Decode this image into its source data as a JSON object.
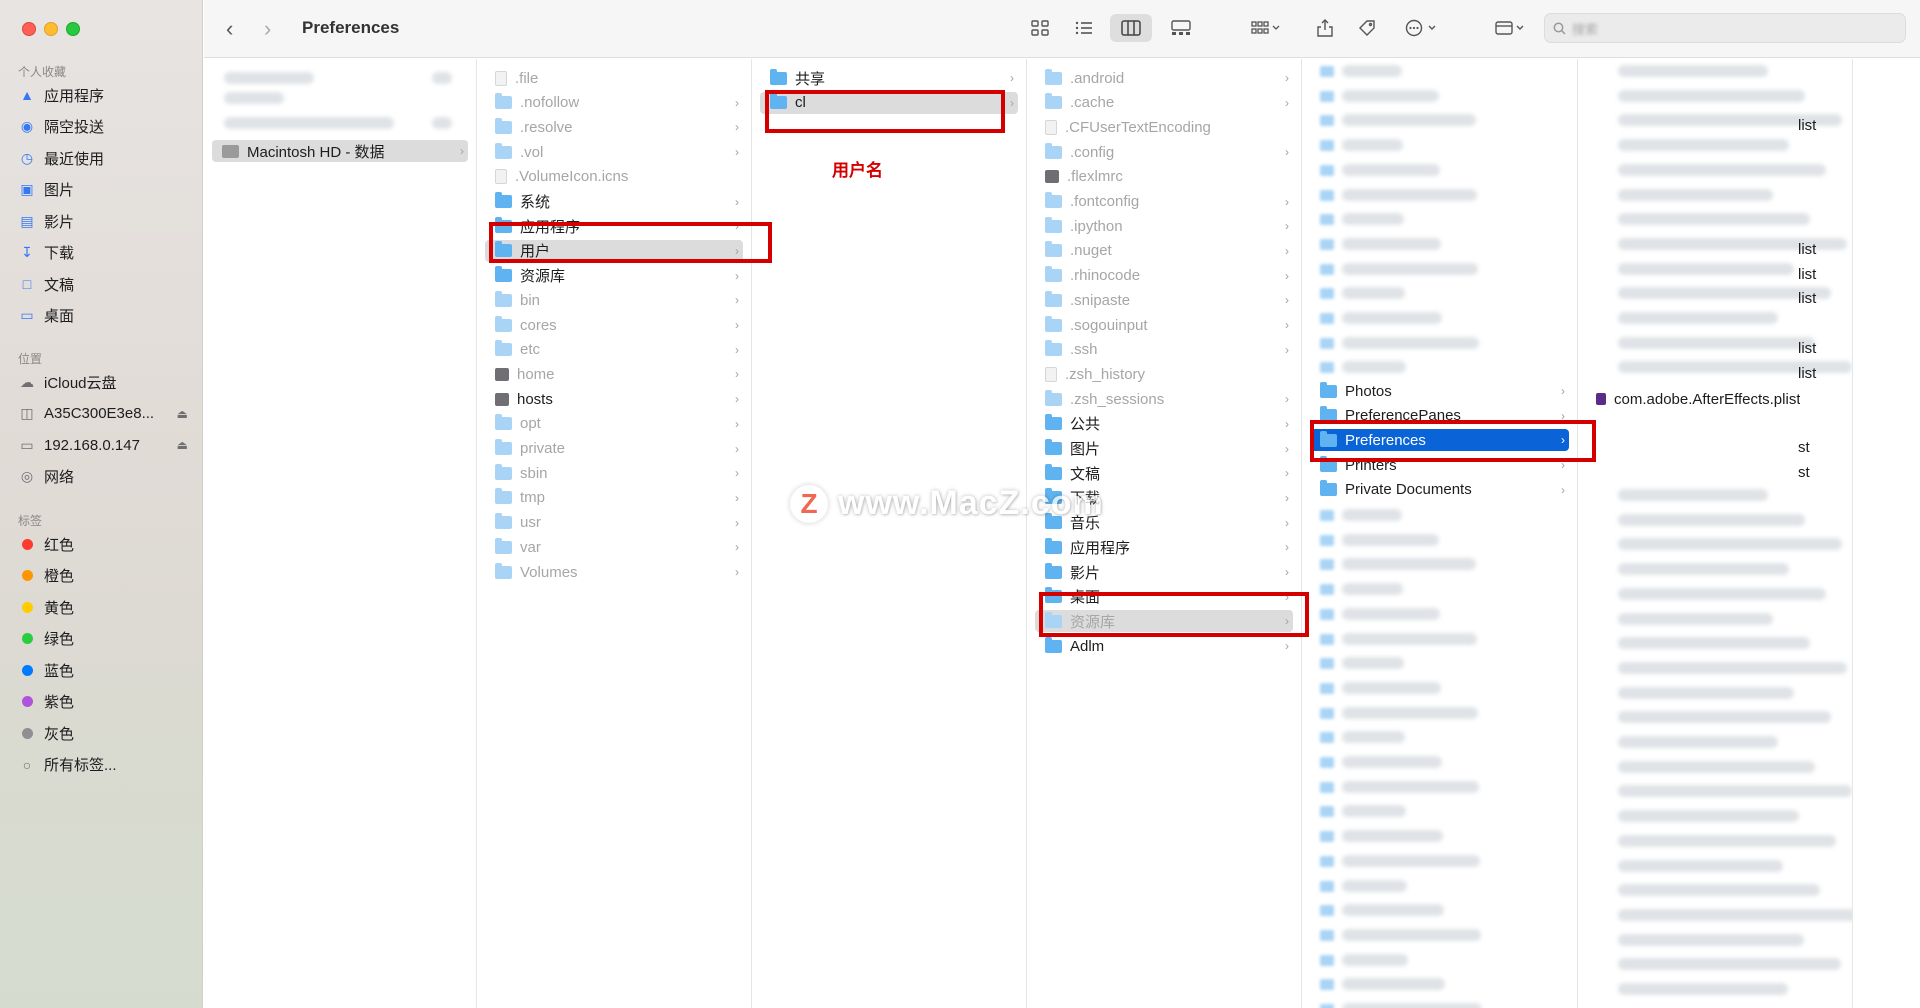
{
  "window": {
    "title": "Preferences"
  },
  "colors": {
    "accent": "#0a64d8",
    "annotation": "#d40000",
    "selection_grey": "#dcdcdc"
  },
  "sidebar": {
    "favorites_header": "个人收藏",
    "favorites": [
      {
        "label": "应用程序",
        "icon": "applications-icon"
      },
      {
        "label": "隔空投送",
        "icon": "airdrop-icon"
      },
      {
        "label": "最近使用",
        "icon": "recents-icon"
      },
      {
        "label": "图片",
        "icon": "pictures-icon"
      },
      {
        "label": "影片",
        "icon": "movies-icon"
      },
      {
        "label": "下载",
        "icon": "downloads-icon"
      },
      {
        "label": "文稿",
        "icon": "documents-icon"
      },
      {
        "label": "桌面",
        "icon": "desktop-icon"
      }
    ],
    "locations_header": "位置",
    "locations": [
      {
        "label": "iCloud云盘",
        "icon": "icloud-icon"
      },
      {
        "label": "A35C300E3e8...",
        "icon": "disk-icon",
        "eject": true
      },
      {
        "label": "192.168.0.147",
        "icon": "display-icon",
        "eject": true
      },
      {
        "label": "网络",
        "icon": "network-icon"
      }
    ],
    "tags_header": "标签",
    "tags": [
      {
        "label": "红色",
        "color": "#ff3b30"
      },
      {
        "label": "橙色",
        "color": "#ff9500"
      },
      {
        "label": "黄色",
        "color": "#ffcc00"
      },
      {
        "label": "绿色",
        "color": "#28cd41"
      },
      {
        "label": "蓝色",
        "color": "#007aff"
      },
      {
        "label": "紫色",
        "color": "#af52de"
      },
      {
        "label": "灰色",
        "color": "#8e8e93"
      },
      {
        "label": "所有标签...",
        "color": ""
      }
    ]
  },
  "toolbar": {
    "search_placeholder": "搜索"
  },
  "columns": {
    "col1": [
      {
        "label": "Macintosh HD - 数据",
        "type": "drive",
        "chevron": true,
        "selected": "grey"
      }
    ],
    "col2": [
      {
        "label": ".file",
        "type": "file",
        "hidden": true
      },
      {
        "label": ".nofollow",
        "type": "folder",
        "hidden": true,
        "chevron": true
      },
      {
        "label": ".resolve",
        "type": "folder",
        "hidden": true,
        "chevron": true
      },
      {
        "label": ".vol",
        "type": "folder",
        "hidden": true,
        "chevron": true
      },
      {
        "label": ".VolumeIcon.icns",
        "type": "file",
        "hidden": true
      },
      {
        "label": "系统",
        "type": "folder",
        "chevron": true
      },
      {
        "label": "应用程序",
        "type": "folder",
        "chevron": true
      },
      {
        "label": "用户",
        "type": "folder",
        "chevron": true,
        "selected": "grey"
      },
      {
        "label": "资源库",
        "type": "folder",
        "chevron": true
      },
      {
        "label": "bin",
        "type": "folder",
        "hidden": true,
        "chevron": true
      },
      {
        "label": "cores",
        "type": "folder",
        "hidden": true,
        "chevron": true
      },
      {
        "label": "etc",
        "type": "folder",
        "hidden": true,
        "chevron": true
      },
      {
        "label": "home",
        "type": "dark",
        "hidden": true,
        "chevron": true
      },
      {
        "label": "hosts",
        "type": "dark",
        "chevron": true
      },
      {
        "label": "opt",
        "type": "folder",
        "hidden": true,
        "chevron": true
      },
      {
        "label": "private",
        "type": "folder",
        "hidden": true,
        "chevron": true
      },
      {
        "label": "sbin",
        "type": "folder",
        "hidden": true,
        "chevron": true
      },
      {
        "label": "tmp",
        "type": "folder",
        "hidden": true,
        "chevron": true
      },
      {
        "label": "usr",
        "type": "folder",
        "hidden": true,
        "chevron": true
      },
      {
        "label": "var",
        "type": "folder",
        "hidden": true,
        "chevron": true
      },
      {
        "label": "Volumes",
        "type": "folder",
        "hidden": true,
        "chevron": true
      }
    ],
    "col3": [
      {
        "label": "共享",
        "type": "folder",
        "chevron": true
      },
      {
        "label": "cl",
        "type": "folder",
        "chevron": true,
        "selected": "grey"
      }
    ],
    "col4": [
      {
        "label": ".android",
        "type": "folder",
        "hidden": true,
        "chevron": true
      },
      {
        "label": ".cache",
        "type": "folder",
        "hidden": true,
        "chevron": true
      },
      {
        "label": ".CFUserTextEncoding",
        "type": "file",
        "hidden": true
      },
      {
        "label": ".config",
        "type": "folder",
        "hidden": true,
        "chevron": true
      },
      {
        "label": ".flexlmrc",
        "type": "dark",
        "hidden": true
      },
      {
        "label": ".fontconfig",
        "type": "folder",
        "hidden": true,
        "chevron": true
      },
      {
        "label": ".ipython",
        "type": "folder",
        "hidden": true,
        "chevron": true
      },
      {
        "label": ".nuget",
        "type": "folder",
        "hidden": true,
        "chevron": true
      },
      {
        "label": ".rhinocode",
        "type": "folder",
        "hidden": true,
        "chevron": true
      },
      {
        "label": ".snipaste",
        "type": "folder",
        "hidden": true,
        "chevron": true
      },
      {
        "label": ".sogouinput",
        "type": "folder",
        "hidden": true,
        "chevron": true
      },
      {
        "label": ".ssh",
        "type": "folder",
        "hidden": true,
        "chevron": true
      },
      {
        "label": ".zsh_history",
        "type": "file",
        "hidden": true
      },
      {
        "label": ".zsh_sessions",
        "type": "folder",
        "hidden": true,
        "chevron": true
      },
      {
        "label": "公共",
        "type": "folder",
        "chevron": true
      },
      {
        "label": "图片",
        "type": "folder",
        "chevron": true
      },
      {
        "label": "文稿",
        "type": "folder",
        "chevron": true
      },
      {
        "label": "下载",
        "type": "folder",
        "chevron": true
      },
      {
        "label": "音乐",
        "type": "folder",
        "chevron": true
      },
      {
        "label": "应用程序",
        "type": "folder",
        "chevron": true
      },
      {
        "label": "影片",
        "type": "folder",
        "chevron": true
      },
      {
        "label": "桌面",
        "type": "folder",
        "chevron": true
      },
      {
        "label": "资源库",
        "type": "folder",
        "hidden": true,
        "chevron": true,
        "selected": "grey"
      },
      {
        "label": "Adlm",
        "type": "folder",
        "chevron": true
      }
    ],
    "col5": [
      {
        "label": "Photos",
        "type": "folder",
        "chevron": true
      },
      {
        "label": "PreferencePanes",
        "type": "folder",
        "chevron": true
      },
      {
        "label": "Preferences",
        "type": "folder",
        "chevron": true,
        "selected": "blue"
      },
      {
        "label": "Printers",
        "type": "folder",
        "chevron": true
      },
      {
        "label": "Private Documents",
        "type": "folder",
        "chevron": true
      }
    ],
    "col6": [
      {
        "label": "com.adobe.AfterEffects.plist",
        "type": "plist"
      }
    ],
    "col6_partial": [
      "list",
      "list",
      "list",
      "list",
      "list",
      "list",
      "st",
      "st"
    ]
  },
  "annotations": {
    "username_label": "用户名"
  },
  "watermark": {
    "letter": "Z",
    "text": "www.MacZ.com"
  }
}
